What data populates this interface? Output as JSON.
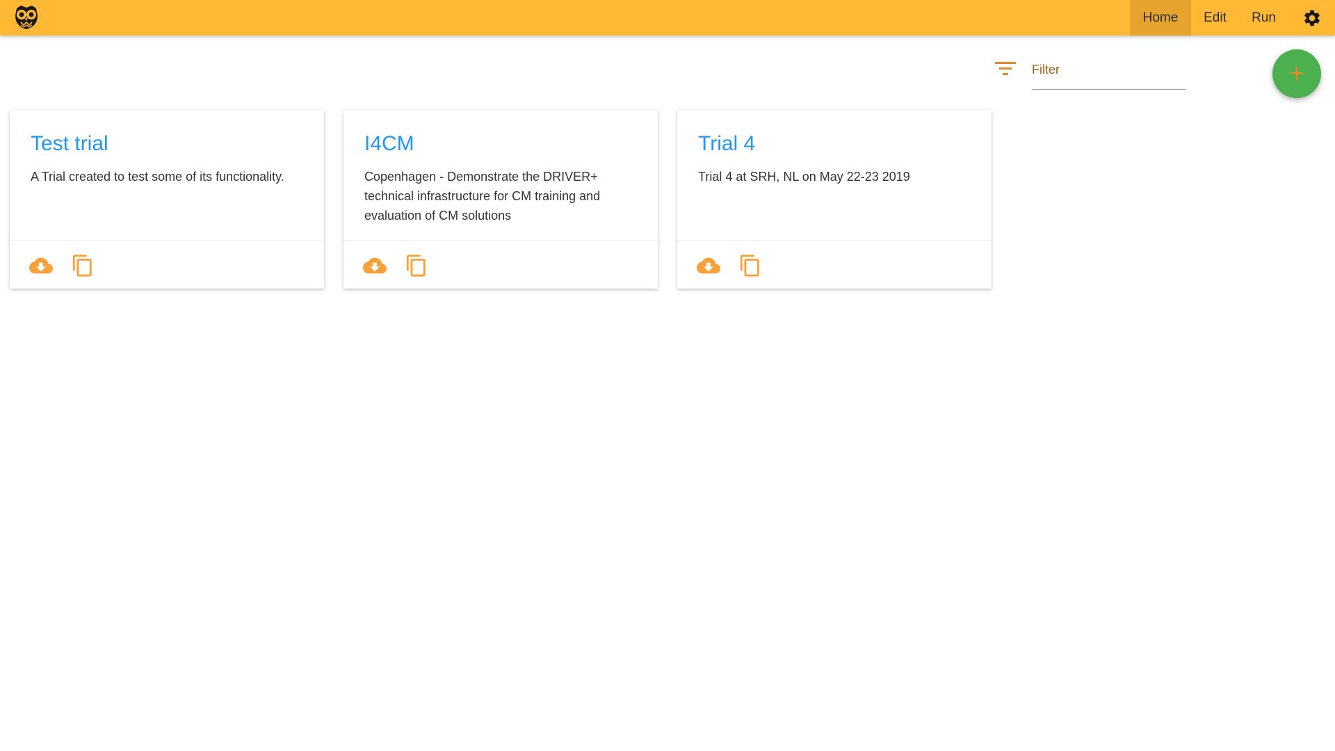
{
  "colors": {
    "navbar": "#ffb935",
    "nav_active": "#e6a42c",
    "accent": "#f7a13a",
    "title": "#2196f3",
    "fab": "#4caf50"
  },
  "nav": {
    "items": [
      {
        "label": "Home",
        "active": true
      },
      {
        "label": "Edit",
        "active": false
      },
      {
        "label": "Run",
        "active": false
      }
    ],
    "settings_icon": "gear-icon",
    "logo_icon": "owl-logo-icon"
  },
  "filter": {
    "placeholder": "Filter",
    "value": "",
    "icon": "filter-list-icon"
  },
  "fab": {
    "label": "+",
    "icon": "add-icon"
  },
  "trials": [
    {
      "title": "Test trial",
      "description": "A Trial created to test some of its functionality."
    },
    {
      "title": "I4CM",
      "description": "Copenhagen - Demonstrate the DRIVER+ technical infrastructure for CM training and evaluation of CM solutions"
    },
    {
      "title": "Trial 4",
      "description": "Trial 4 at SRH, NL on May 22-23 2019"
    }
  ],
  "card_actions": [
    {
      "icon": "cloud-download-icon"
    },
    {
      "icon": "copy-icon"
    }
  ]
}
